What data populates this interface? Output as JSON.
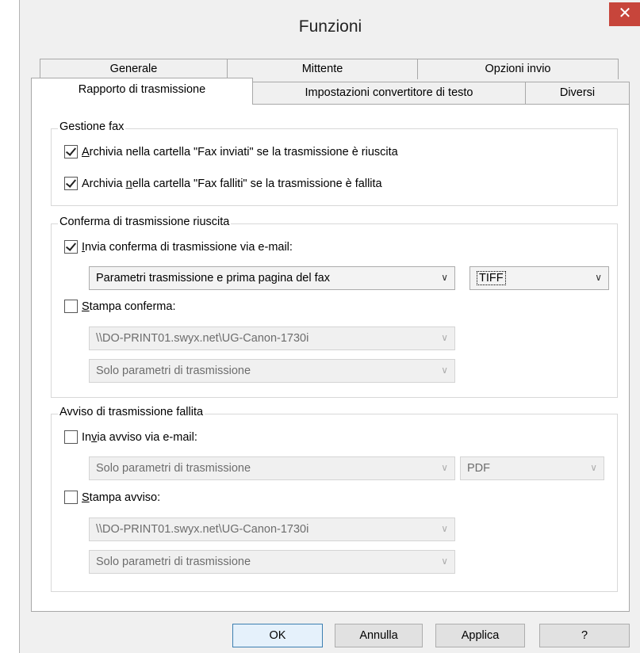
{
  "window": {
    "title": "Funzioni",
    "close_glyph": "✕",
    "close_icon": "close-icon"
  },
  "tabs": {
    "row1": [
      "Generale",
      "Mittente",
      "Opzioni invio"
    ],
    "row2": [
      "Rapporto di trasmissione",
      "Impostazioni convertitore di testo",
      "Diversi"
    ],
    "active": "Rapporto di trasmissione"
  },
  "fax_management": {
    "legend": "Gestione fax",
    "archive_sent": {
      "pre": "",
      "key": "A",
      "post": "rchivia nella cartella  \"Fax inviati\" se la trasmissione è riuscita",
      "checked": true
    },
    "archive_failed": {
      "pre": "Archivia ",
      "key": "n",
      "post": "ella cartella \"Fax falliti\" se la trasmissione è fallita",
      "checked": true
    }
  },
  "success_confirmation": {
    "legend": "Conferma di trasmissione riuscita",
    "email": {
      "pre": "",
      "key": "I",
      "post": "nvia conferma di trasmissione via e-mail:",
      "checked": true
    },
    "email_content": "Parametri trasmissione e prima pagina del fax",
    "email_format": "TIFF",
    "print": {
      "pre": "",
      "key": "S",
      "post": "tampa conferma:",
      "checked": false
    },
    "printer": "\\\\DO-PRINT01.swyx.net\\UG-Canon-1730i",
    "print_content": "Solo parametri di trasmissione"
  },
  "failure_notice": {
    "legend": "Avviso di trasmissione fallita",
    "email": {
      "pre": "In",
      "key": "v",
      "post": "ia avviso via e-mail:",
      "checked": false
    },
    "email_content": "Solo parametri di trasmissione",
    "email_format": "PDF",
    "print": {
      "pre": "",
      "key": "S",
      "post": "tampa avviso:",
      "checked": false
    },
    "printer": "\\\\DO-PRINT01.swyx.net\\UG-Canon-1730i",
    "print_content": "Solo parametri di trasmissione"
  },
  "buttons": {
    "ok": "OK",
    "cancel": "Annulla",
    "apply": "Applica",
    "help": "?"
  },
  "arrow_glyph": "∨",
  "colors": {
    "close_bg": "#c7453b",
    "default_button_border": "#3c7fb1"
  }
}
